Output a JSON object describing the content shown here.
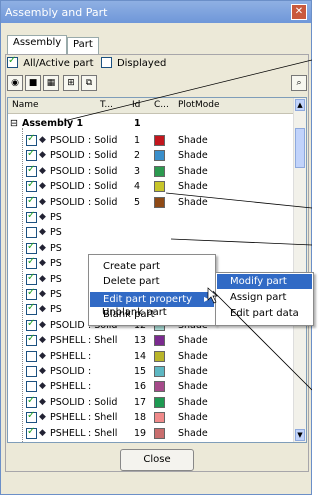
{
  "window": {
    "title": "Assembly and Part",
    "close_glyph": "✕"
  },
  "tabs": [
    {
      "label": "Assembly"
    },
    {
      "label": "Part"
    }
  ],
  "filters": {
    "all_active_label": "All/Active part",
    "displayed_label": "Displayed"
  },
  "toolbar": {
    "icons": [
      "display-icon",
      "shade-icon",
      "wireframe-icon",
      "tree-icon",
      "copy-icon"
    ],
    "search_icon": "search-icon"
  },
  "list": {
    "columns": [
      "Name",
      "T...",
      "Id",
      "C...",
      "PlotMode"
    ],
    "assembly": {
      "name": "Assembly 1",
      "id": "1"
    },
    "rows": [
      {
        "name": "PSOLID",
        "type": ": Solid",
        "id": "1",
        "color": "#c3161d",
        "mode": "Shade",
        "checked": true
      },
      {
        "name": "PSOLID",
        "type": ": Solid",
        "id": "2",
        "color": "#3a8fcb",
        "mode": "Shade",
        "checked": true
      },
      {
        "name": "PSOLID",
        "type": ": Solid",
        "id": "3",
        "color": "#2c9a4f",
        "mode": "Shade",
        "checked": true
      },
      {
        "name": "PSOLID",
        "type": ": Solid",
        "id": "4",
        "color": "#c7c52a",
        "mode": "Shade",
        "checked": true
      },
      {
        "name": "PSOLID",
        "type": ": Solid",
        "id": "5",
        "color": "#8f4a16",
        "mode": "Shade",
        "checked": true
      },
      {
        "name": "PS",
        "type": "",
        "id": "",
        "color": "",
        "mode": "",
        "checked": true
      },
      {
        "name": "PS",
        "type": "",
        "id": "",
        "color": "",
        "mode": "",
        "checked": false
      },
      {
        "name": "PS",
        "type": "",
        "id": "",
        "color": "",
        "mode": "",
        "checked": true
      },
      {
        "name": "PS",
        "type": "",
        "id": "",
        "color": "",
        "mode": "",
        "checked": true
      },
      {
        "name": "PS",
        "type": "",
        "id": "",
        "color": "",
        "mode": "",
        "checked": true
      },
      {
        "name": "PS",
        "type": "",
        "id": "",
        "color": "",
        "mode": "",
        "checked": true
      },
      {
        "name": "PS",
        "type": "",
        "id": "",
        "color": "",
        "mode": "",
        "checked": true
      },
      {
        "name": "PSOLID",
        "type": ": Solid",
        "id": "12",
        "color": "#a9dcd6",
        "mode": "Shade",
        "checked": true
      },
      {
        "name": "PSHELL",
        "type": ": Shell",
        "id": "13",
        "color": "#7b2a8f",
        "mode": "Shade",
        "checked": true
      },
      {
        "name": "PSHELL",
        "type": ":",
        "id": "14",
        "color": "#b9b52a",
        "mode": "Shade",
        "checked": false
      },
      {
        "name": "PSOLID",
        "type": ":",
        "id": "15",
        "color": "#5db7c2",
        "mode": "Shade",
        "checked": false
      },
      {
        "name": "PSHELL",
        "type": ":",
        "id": "16",
        "color": "#a64a8a",
        "mode": "Shade",
        "checked": false
      },
      {
        "name": "PSOLID",
        "type": ": Solid",
        "id": "17",
        "color": "#1e9a52",
        "mode": "Shade",
        "checked": true
      },
      {
        "name": "PSHELL",
        "type": ": Shell",
        "id": "18",
        "color": "#f08a8a",
        "mode": "Shade",
        "checked": true
      },
      {
        "name": "PSHELL",
        "type": ": Shell",
        "id": "19",
        "color": "#c96e6e",
        "mode": "Shade",
        "checked": true
      }
    ]
  },
  "context_menu": {
    "items": [
      "Create part",
      "Delete part",
      "Edit part property",
      "Blank part",
      "Unblank part"
    ],
    "highlighted": "Edit part property"
  },
  "submenu": {
    "items": [
      "Modify part",
      "Assign part",
      "Edit part data"
    ],
    "highlighted": "Modify part"
  },
  "footer": {
    "close_label": "Close"
  },
  "accent": "#316ac5"
}
